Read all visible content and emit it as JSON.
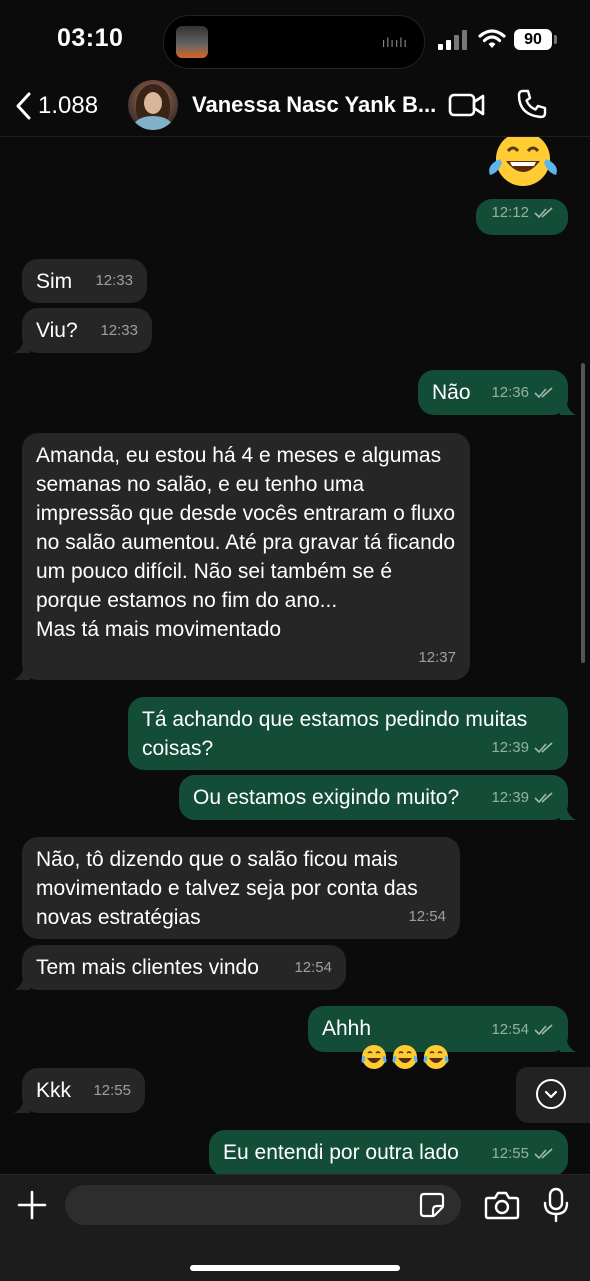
{
  "status_bar": {
    "time": "03:10",
    "battery": "90"
  },
  "header": {
    "back_count": "1.088",
    "contact_name": "Vanessa Nasc Yank B..."
  },
  "messages": [
    {
      "dir": "out",
      "emoji": "😂",
      "time": "12:12"
    },
    {
      "dir": "in",
      "text": "Sim",
      "time": "12:33"
    },
    {
      "dir": "in",
      "text": "Viu?",
      "time": "12:33"
    },
    {
      "dir": "out",
      "text": "Não",
      "time": "12:36"
    },
    {
      "dir": "in",
      "text": "Amanda, eu estou há 4 e meses e algumas semanas no salão, e eu tenho uma impressão que desde vocês entraram o fluxo no salão aumentou. Até pra gravar tá ficando um pouco difícil. Não sei também se é porque estamos no fim do ano...\nMas tá mais movimentado",
      "time": "12:37"
    },
    {
      "dir": "out",
      "text": "Tá achando que estamos pedindo muitas coisas?",
      "time": "12:39"
    },
    {
      "dir": "out",
      "text": "Ou estamos exigindo muito?",
      "time": "12:39"
    },
    {
      "dir": "in",
      "text": "Não, tô dizendo que o salão ficou mais movimentado e talvez seja por conta das novas estratégias",
      "time": "12:54"
    },
    {
      "dir": "in",
      "text": "Tem mais clientes vindo",
      "time": "12:54"
    },
    {
      "dir": "out",
      "text": "Ahhh",
      "emoji_suffix": "😂😂😂",
      "time": "12:54"
    },
    {
      "dir": "in",
      "text": "Kkk",
      "time": "12:55"
    },
    {
      "dir": "out",
      "text": "Eu entendi por outra lado",
      "time": "12:55"
    }
  ],
  "input": {
    "placeholder": ""
  },
  "colors": {
    "incoming_bubble": "#262626",
    "outgoing_bubble": "#134d37",
    "background": "#0b0b0b"
  }
}
